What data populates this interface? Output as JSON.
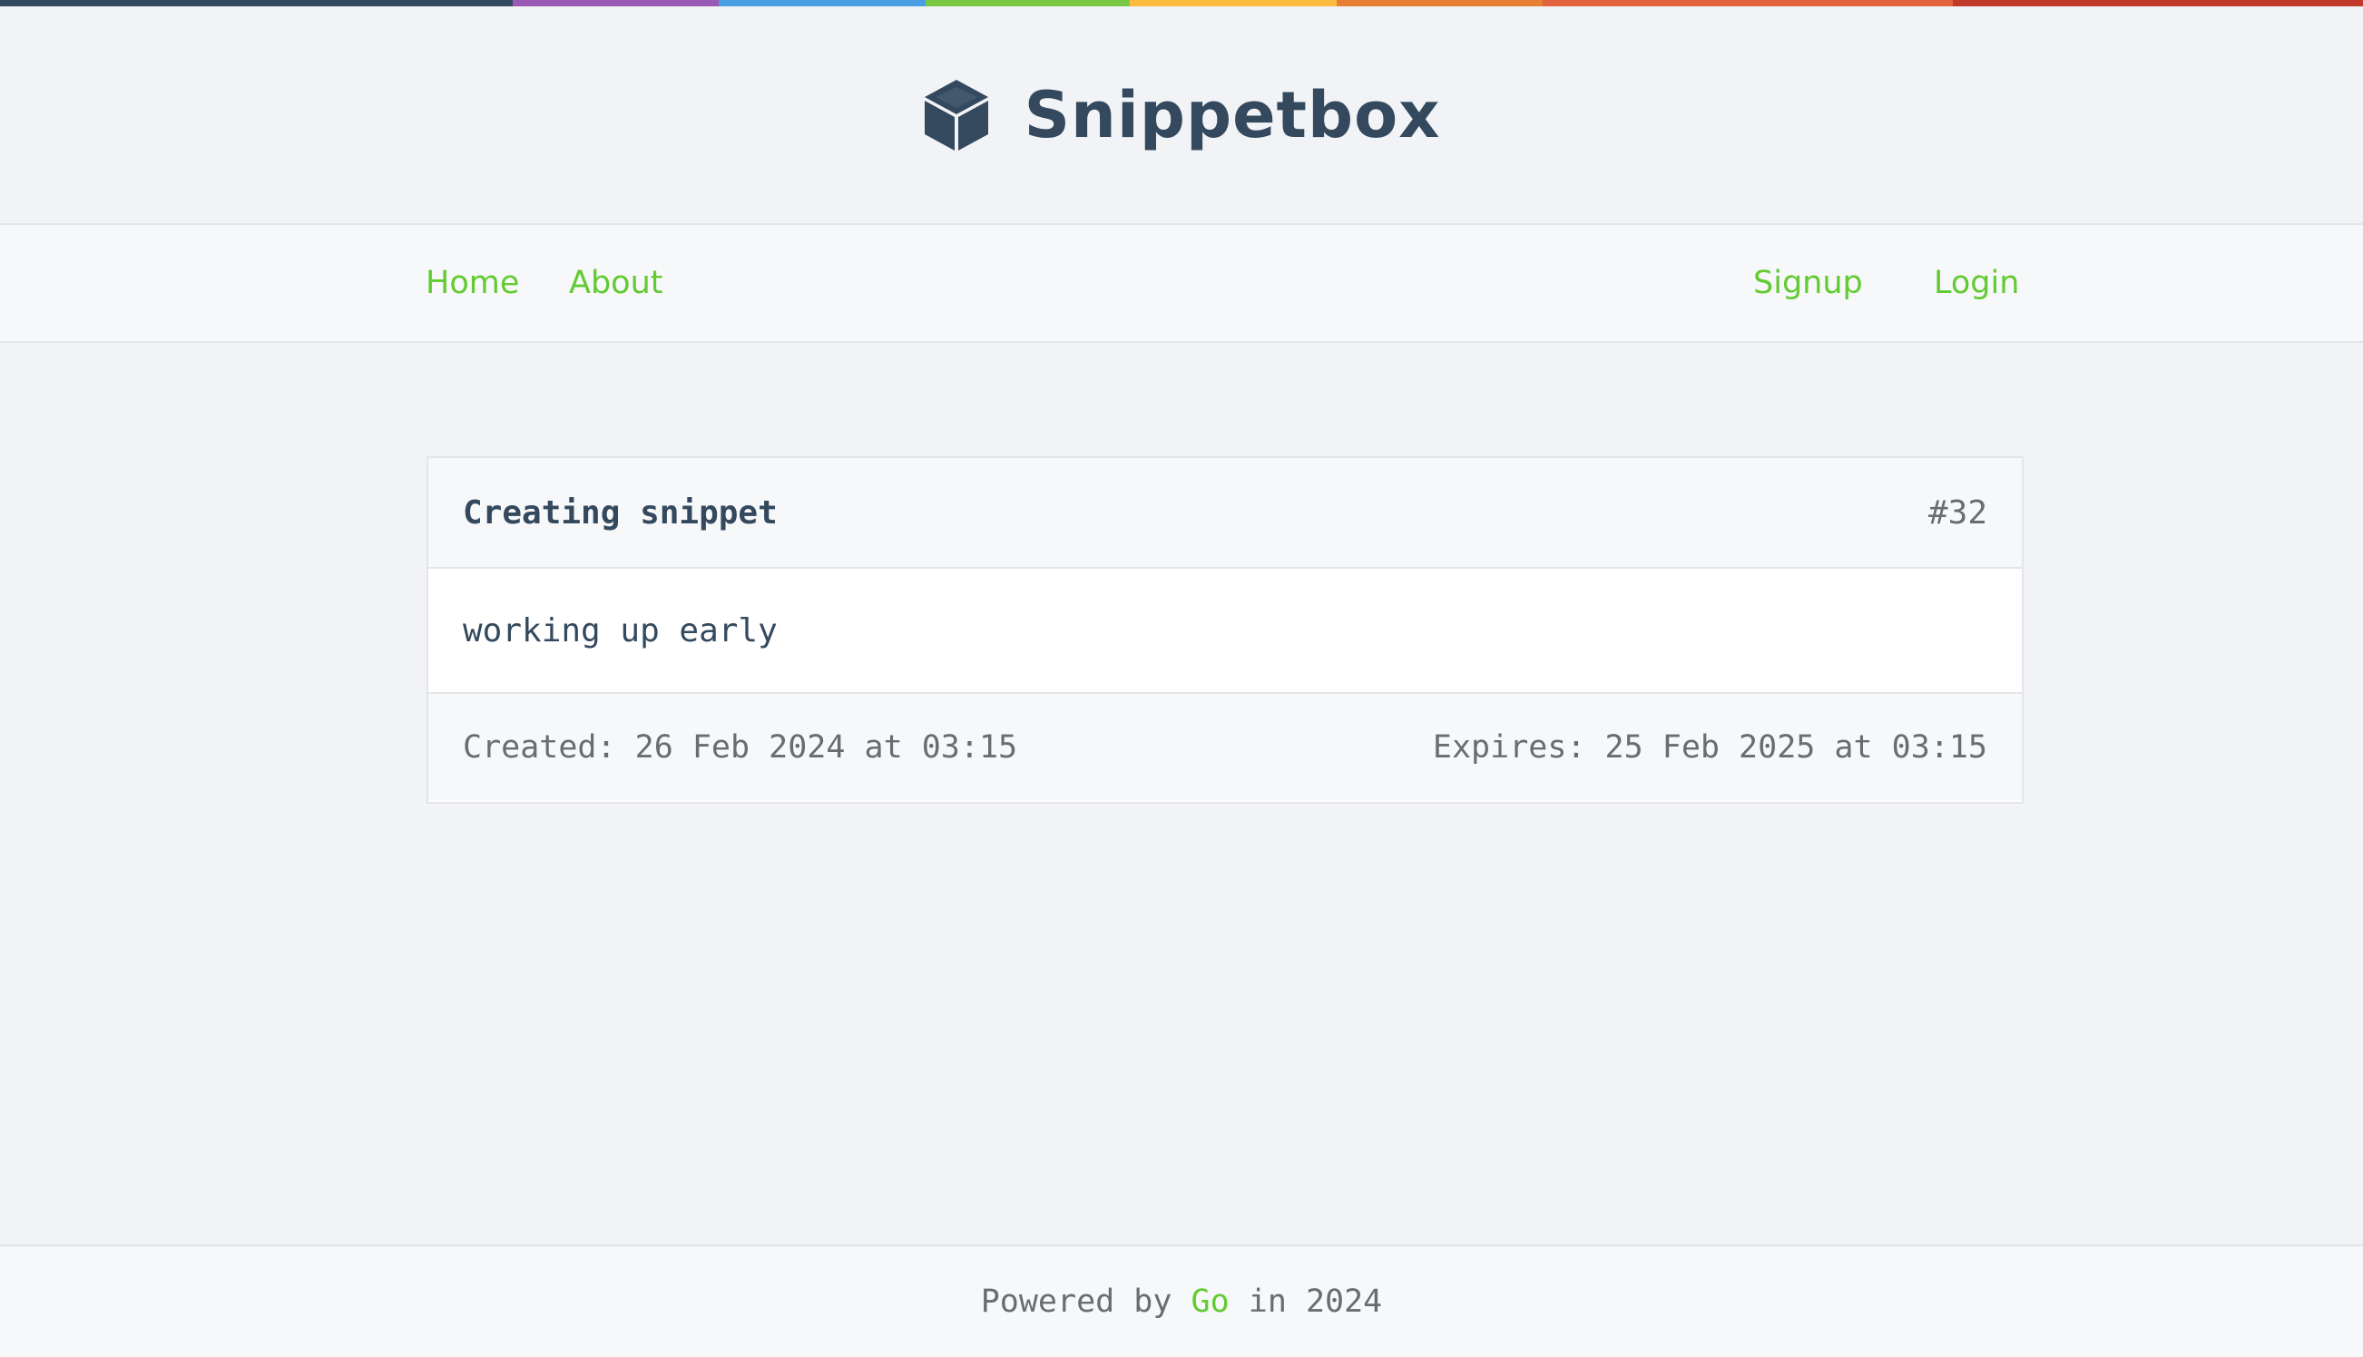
{
  "colors": {
    "stripe": [
      "#34495e",
      "#9b59b6",
      "#4a9ee4",
      "#79c944",
      "#fdbc40",
      "#e67e34",
      "#e0633e",
      "#c0392b"
    ],
    "accent": "#62cb31",
    "text": "#34495e",
    "muted": "#6a6c6f"
  },
  "header": {
    "icon": "cube-icon",
    "title": "Snippetbox"
  },
  "nav": {
    "left": [
      {
        "label": "Home"
      },
      {
        "label": "About"
      }
    ],
    "right": [
      {
        "label": "Signup"
      },
      {
        "label": "Login"
      }
    ]
  },
  "snippet": {
    "title": "Creating snippet",
    "id": "#32",
    "content": "working up early",
    "created": "Created: 26 Feb 2024 at 03:15",
    "expires": "Expires: 25 Feb 2025 at 03:15"
  },
  "footer": {
    "prefix": "Powered by",
    "link": "Go",
    "suffix": "in 2024"
  }
}
